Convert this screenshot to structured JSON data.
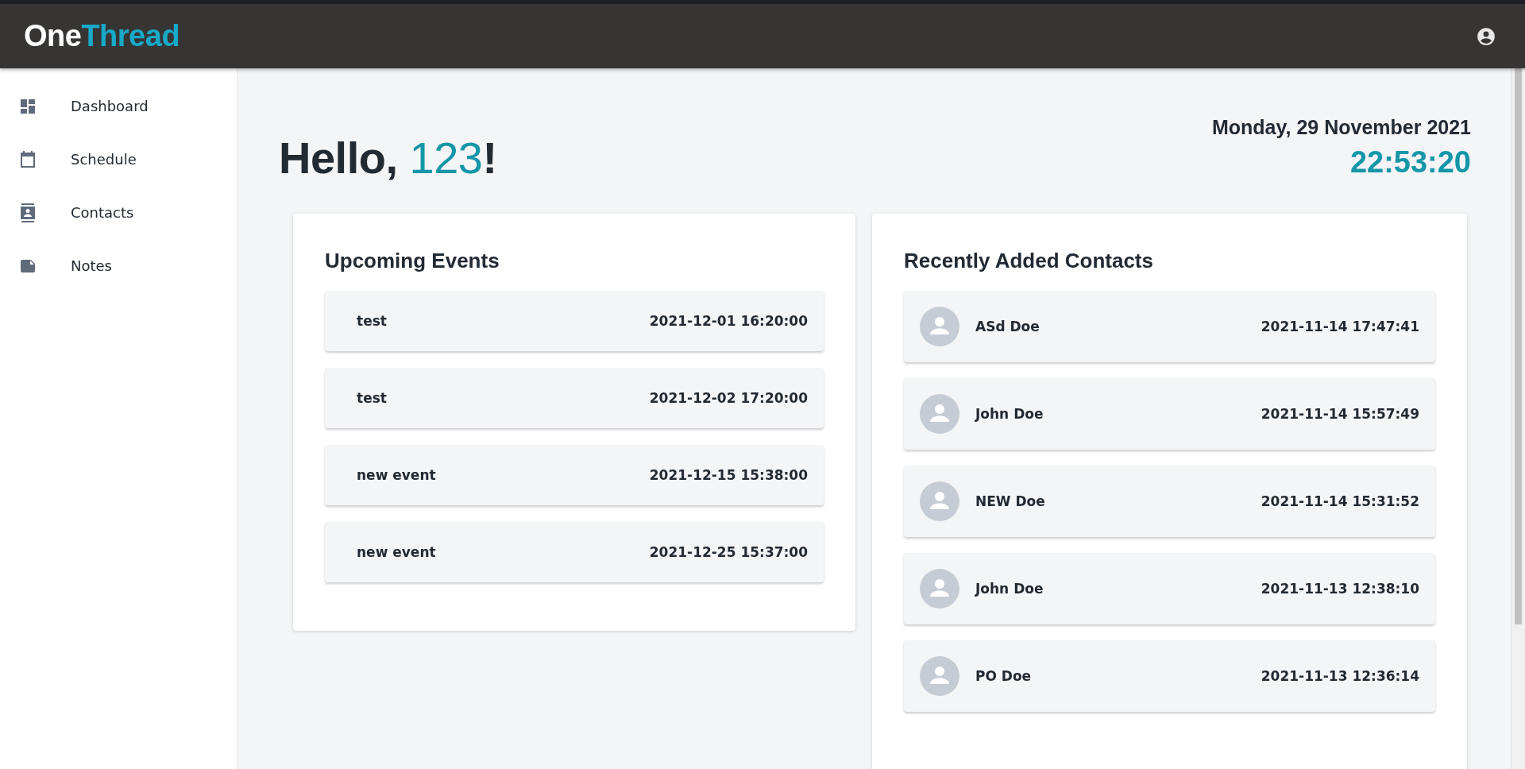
{
  "app": {
    "brand_first": "One",
    "brand_second": "Thread"
  },
  "sidebar": {
    "items": [
      {
        "label": "Dashboard",
        "kind": "dashboard",
        "selected": false
      },
      {
        "label": "Schedule",
        "kind": "calendar",
        "selected": false
      },
      {
        "label": "Contacts",
        "kind": "contacts",
        "selected": false
      },
      {
        "label": "Notes",
        "kind": "note",
        "selected": false
      }
    ]
  },
  "greeting": {
    "prefix": "Hello, ",
    "name": "123",
    "suffix": "!"
  },
  "date": "Monday, 29 November 2021",
  "time": "22:53:20",
  "upcoming_events": {
    "title": "Upcoming Events",
    "items": [
      {
        "name": "test",
        "datetime": "2021-12-01 16:20:00"
      },
      {
        "name": "test",
        "datetime": "2021-12-02 17:20:00"
      },
      {
        "name": "new event",
        "datetime": "2021-12-15 15:38:00"
      },
      {
        "name": "new event",
        "datetime": "2021-12-25 15:37:00"
      }
    ]
  },
  "recent_contacts": {
    "title": "Recently Added Contacts",
    "items": [
      {
        "name": "ASd Doe",
        "added": "2021-11-14 17:47:41"
      },
      {
        "name": "John Doe",
        "added": "2021-11-14 15:57:49"
      },
      {
        "name": "NEW Doe",
        "added": "2021-11-14 15:31:52"
      },
      {
        "name": "John Doe",
        "added": "2021-11-13 12:38:10"
      },
      {
        "name": "PO Doe",
        "added": "2021-11-13 12:36:14"
      }
    ]
  }
}
